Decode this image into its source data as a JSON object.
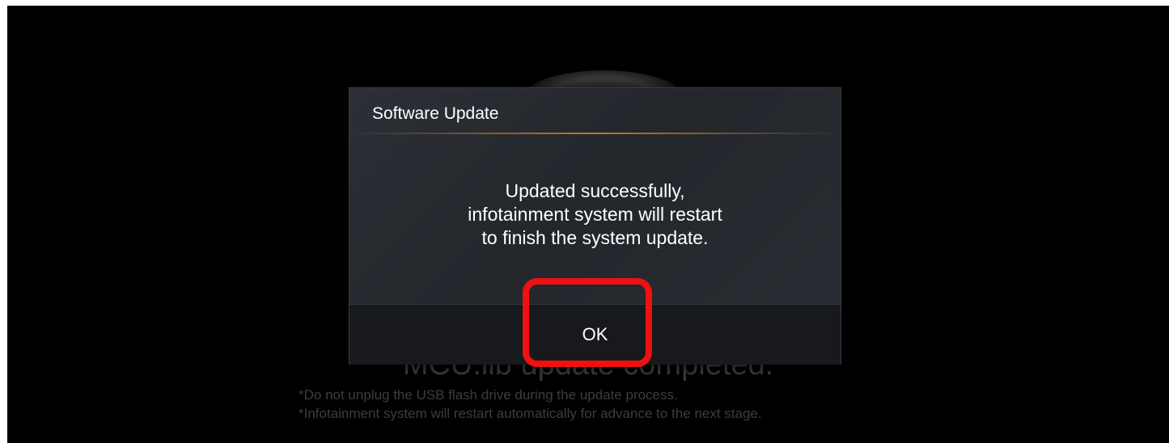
{
  "background": {
    "status_text": "MCU.lib update completed.",
    "notes": [
      "*Do not unplug the USB flash drive during the update process.",
      "*Infotainment system will restart automatically for advance to the next stage."
    ]
  },
  "dialog": {
    "title": "Software Update",
    "message_lines": [
      "Updated successfully,",
      "infotainment system will restart",
      "to finish the system update."
    ],
    "ok_label": "OK"
  },
  "colors": {
    "highlight": "#ee1111",
    "dialog_bg": "#2a2e34",
    "footer_bg": "#17191c",
    "divider_accent": "#b07a45"
  }
}
